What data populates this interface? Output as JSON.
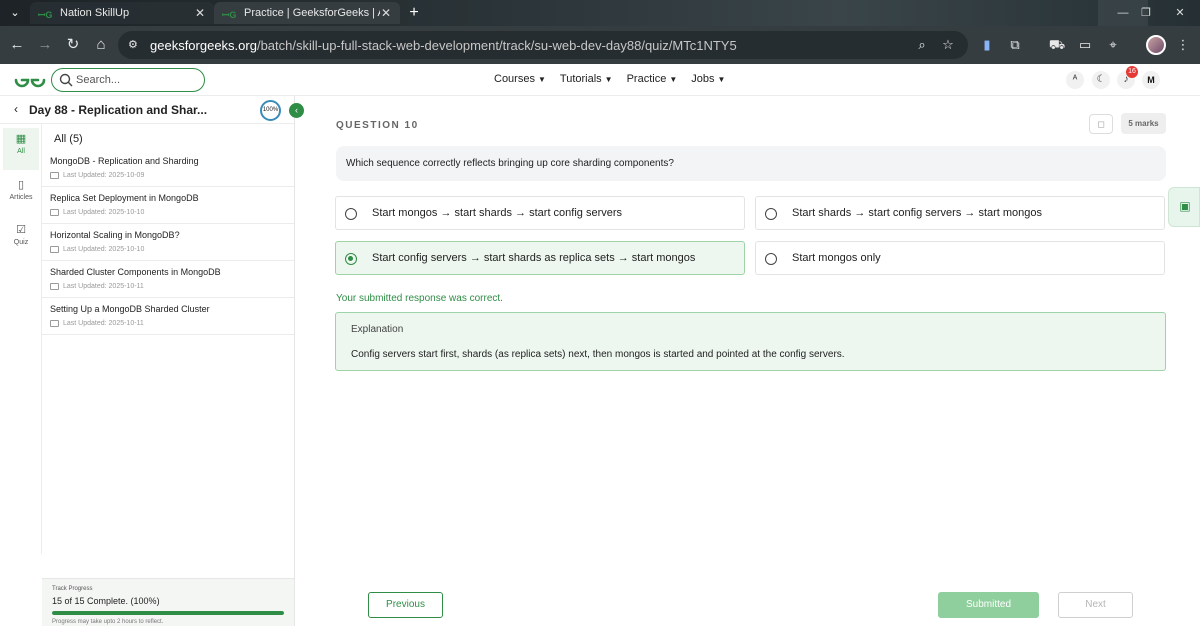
{
  "browser": {
    "tabs": [
      {
        "title": "Nation SkillUp",
        "active": false
      },
      {
        "title": "Practice | GeeksforGeeks | A co...",
        "active": true
      }
    ],
    "url_host": "geeksforgeeks.org",
    "url_path": "/batch/skill-up-full-stack-web-development/track/su-web-dev-day88/quiz/MTc1NTY5"
  },
  "header": {
    "search_placeholder": "Search...",
    "nav": [
      "Courses",
      "Tutorials",
      "Practice",
      "Jobs"
    ],
    "notification_count": "16",
    "avatar_letter": "M"
  },
  "sidebar": {
    "title": "Day 88 - Replication and Shar...",
    "completion": "100%",
    "rail": [
      {
        "label": "All",
        "icon": "grid-icon",
        "active": true
      },
      {
        "label": "Articles",
        "icon": "book-icon",
        "active": false
      },
      {
        "label": "Quiz",
        "icon": "quiz-icon",
        "active": false
      }
    ],
    "list_heading": "All (5)",
    "lessons": [
      {
        "title": "MongoDB - Replication and Sharding",
        "updated": "Last Updated: 2025-10-09"
      },
      {
        "title": "Replica Set Deployment in MongoDB",
        "updated": "Last Updated: 2025-10-10"
      },
      {
        "title": "Horizontal Scaling in MongoDB?",
        "updated": "Last Updated: 2025-10-10"
      },
      {
        "title": "Sharded Cluster Components in MongoDB",
        "updated": "Last Updated: 2025-10-11"
      },
      {
        "title": "Setting Up a MongoDB Sharded Cluster",
        "updated": "Last Updated: 2025-10-11"
      }
    ],
    "progress": {
      "label": "Track Progress",
      "count_text": "15 of 15 Complete. (100%)",
      "fraction": 1.0,
      "note": "Progress may take upto 2 hours to reflect."
    }
  },
  "quiz": {
    "question_number": "QUESTION 10",
    "marks": "5 marks",
    "question": "Which sequence correctly reflects bringing up core sharding components?",
    "options": [
      {
        "text": "Start mongos → start shards → start config servers",
        "selected": false
      },
      {
        "text": "Start shards → start config servers → start mongos",
        "selected": false
      },
      {
        "text": "Start config servers → start shards as replica sets → start mongos",
        "selected": true
      },
      {
        "text": "Start mongos only",
        "selected": false
      }
    ],
    "result": "Your submitted response was correct.",
    "explanation_heading": "Explanation",
    "explanation": "Config servers start first, shards (as replica sets) next, then mongos is started and pointed at the config servers.",
    "buttons": {
      "previous": "Previous",
      "submitted": "Submitted",
      "next": "Next"
    }
  },
  "colors": {
    "accent": "#2f8d46",
    "correct_bg": "#edf7ef",
    "correct_border": "#9ed3aa"
  }
}
